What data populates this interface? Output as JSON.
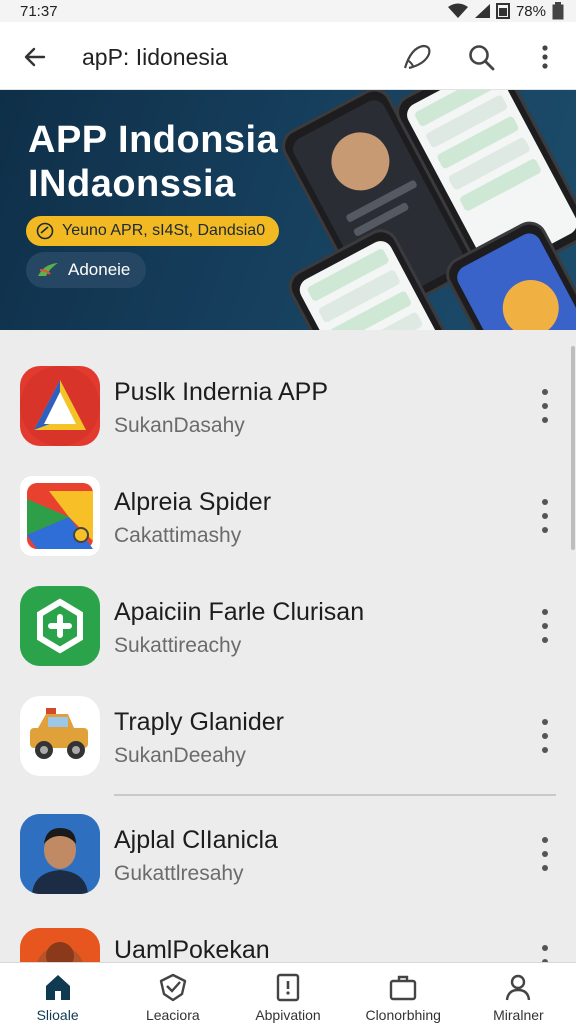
{
  "status": {
    "time": "71:37",
    "battery": "78%"
  },
  "header": {
    "title": "apP: Iidonesia"
  },
  "banner": {
    "title_line1": "APP Indonsia",
    "title_line2": "INdaonssia",
    "pill_text": "Yeuno APR, sI4St, Dandsia0",
    "button_label": "Adoneie"
  },
  "apps": [
    {
      "name": "Puslk Indernia APP",
      "sub": "SukanDasahy"
    },
    {
      "name": "Alpreia Spider",
      "sub": "Cakattimashy"
    },
    {
      "name": "Apaiciin Farle Clurisan",
      "sub": "Sukattireachy"
    },
    {
      "name": "Traply Glanider",
      "sub": "SukanDeeahy"
    },
    {
      "name": "Ajplal ClIanicla",
      "sub": "Gukattlresahy"
    },
    {
      "name": "UamlPokekan",
      "sub": ""
    }
  ],
  "nav": [
    {
      "label": "Slioale",
      "icon": "home-icon"
    },
    {
      "label": "Leaciora",
      "icon": "shield-check-icon"
    },
    {
      "label": "Abpivation",
      "icon": "document-alert-icon"
    },
    {
      "label": "Clonorbhing",
      "icon": "briefcase-icon"
    },
    {
      "label": "Miralner",
      "icon": "user-icon"
    }
  ],
  "colors": {
    "banner_bg": "#153e5c",
    "pill": "#f2b922",
    "nav_active": "#0f3a52"
  }
}
